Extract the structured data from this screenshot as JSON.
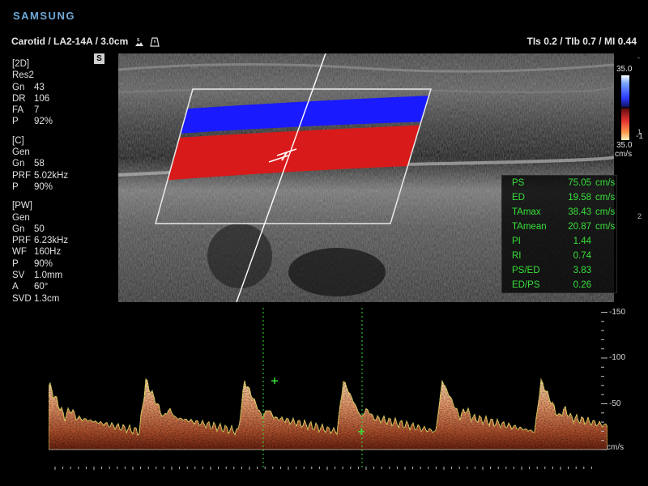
{
  "brand": "SAMSUNG",
  "header": {
    "exam": "Carotid / LA2-14A / 3.0cm",
    "tis": "TIs",
    "tis_val": "0.2",
    "tib": "TIb",
    "tib_val": "0.7",
    "mi": "MI",
    "mi_val": "0.44",
    "icons": [
      "harmonic-icon",
      "probe-icon"
    ]
  },
  "params": {
    "mode_2d": {
      "title": "[2D]",
      "preset": "Res2",
      "rows": [
        [
          "Gn",
          "43"
        ],
        [
          "DR",
          "106"
        ],
        [
          "FA",
          "7"
        ],
        [
          "P",
          "92%"
        ]
      ]
    },
    "mode_c": {
      "title": "[C]",
      "preset": "Gen",
      "rows": [
        [
          "Gn",
          "58"
        ],
        [
          "PRF",
          "5.02kHz"
        ],
        [
          "P",
          "90%"
        ]
      ]
    },
    "mode_pw": {
      "title": "[PW]",
      "preset": "Gen",
      "rows": [
        [
          "Gn",
          "50"
        ],
        [
          "PRF",
          "6.23kHz"
        ],
        [
          "WF",
          "160Hz"
        ],
        [
          "P",
          "90%"
        ],
        [
          "SV",
          "1.0mm"
        ],
        [
          "A",
          "60°"
        ],
        [
          "SVD",
          "1.3cm"
        ]
      ]
    }
  },
  "s_badge": "S",
  "color_scale": {
    "top": "35.0",
    "bottom": "35.0",
    "unit": "cm/s",
    "baseline_mark": "-1"
  },
  "depth_ticks": [
    "-",
    "1",
    "2"
  ],
  "measurements": [
    {
      "label": "PS",
      "value": "75.05",
      "unit": "cm/s"
    },
    {
      "label": "ED",
      "value": "19.58",
      "unit": "cm/s"
    },
    {
      "label": "TAmax",
      "value": "38.43",
      "unit": "cm/s"
    },
    {
      "label": "TAmean",
      "value": "20.87",
      "unit": "cm/s"
    },
    {
      "label": "PI",
      "value": "1.44",
      "unit": ""
    },
    {
      "label": "RI",
      "value": "0.74",
      "unit": ""
    },
    {
      "label": "PS/ED",
      "value": "3.83",
      "unit": ""
    },
    {
      "label": "ED/PS",
      "value": "0.26",
      "unit": ""
    }
  ],
  "spectral": {
    "velocity_labels": [
      "-150",
      "-100",
      "-50"
    ],
    "unit": "cm/s",
    "ps_cms": 75.05,
    "ed_cms": 19.58
  },
  "colors": {
    "flow_blue": "#1a1aff",
    "flow_red": "#d81a1a",
    "measure_green": "#38e03b",
    "brand_blue": "#6fa8d6"
  }
}
